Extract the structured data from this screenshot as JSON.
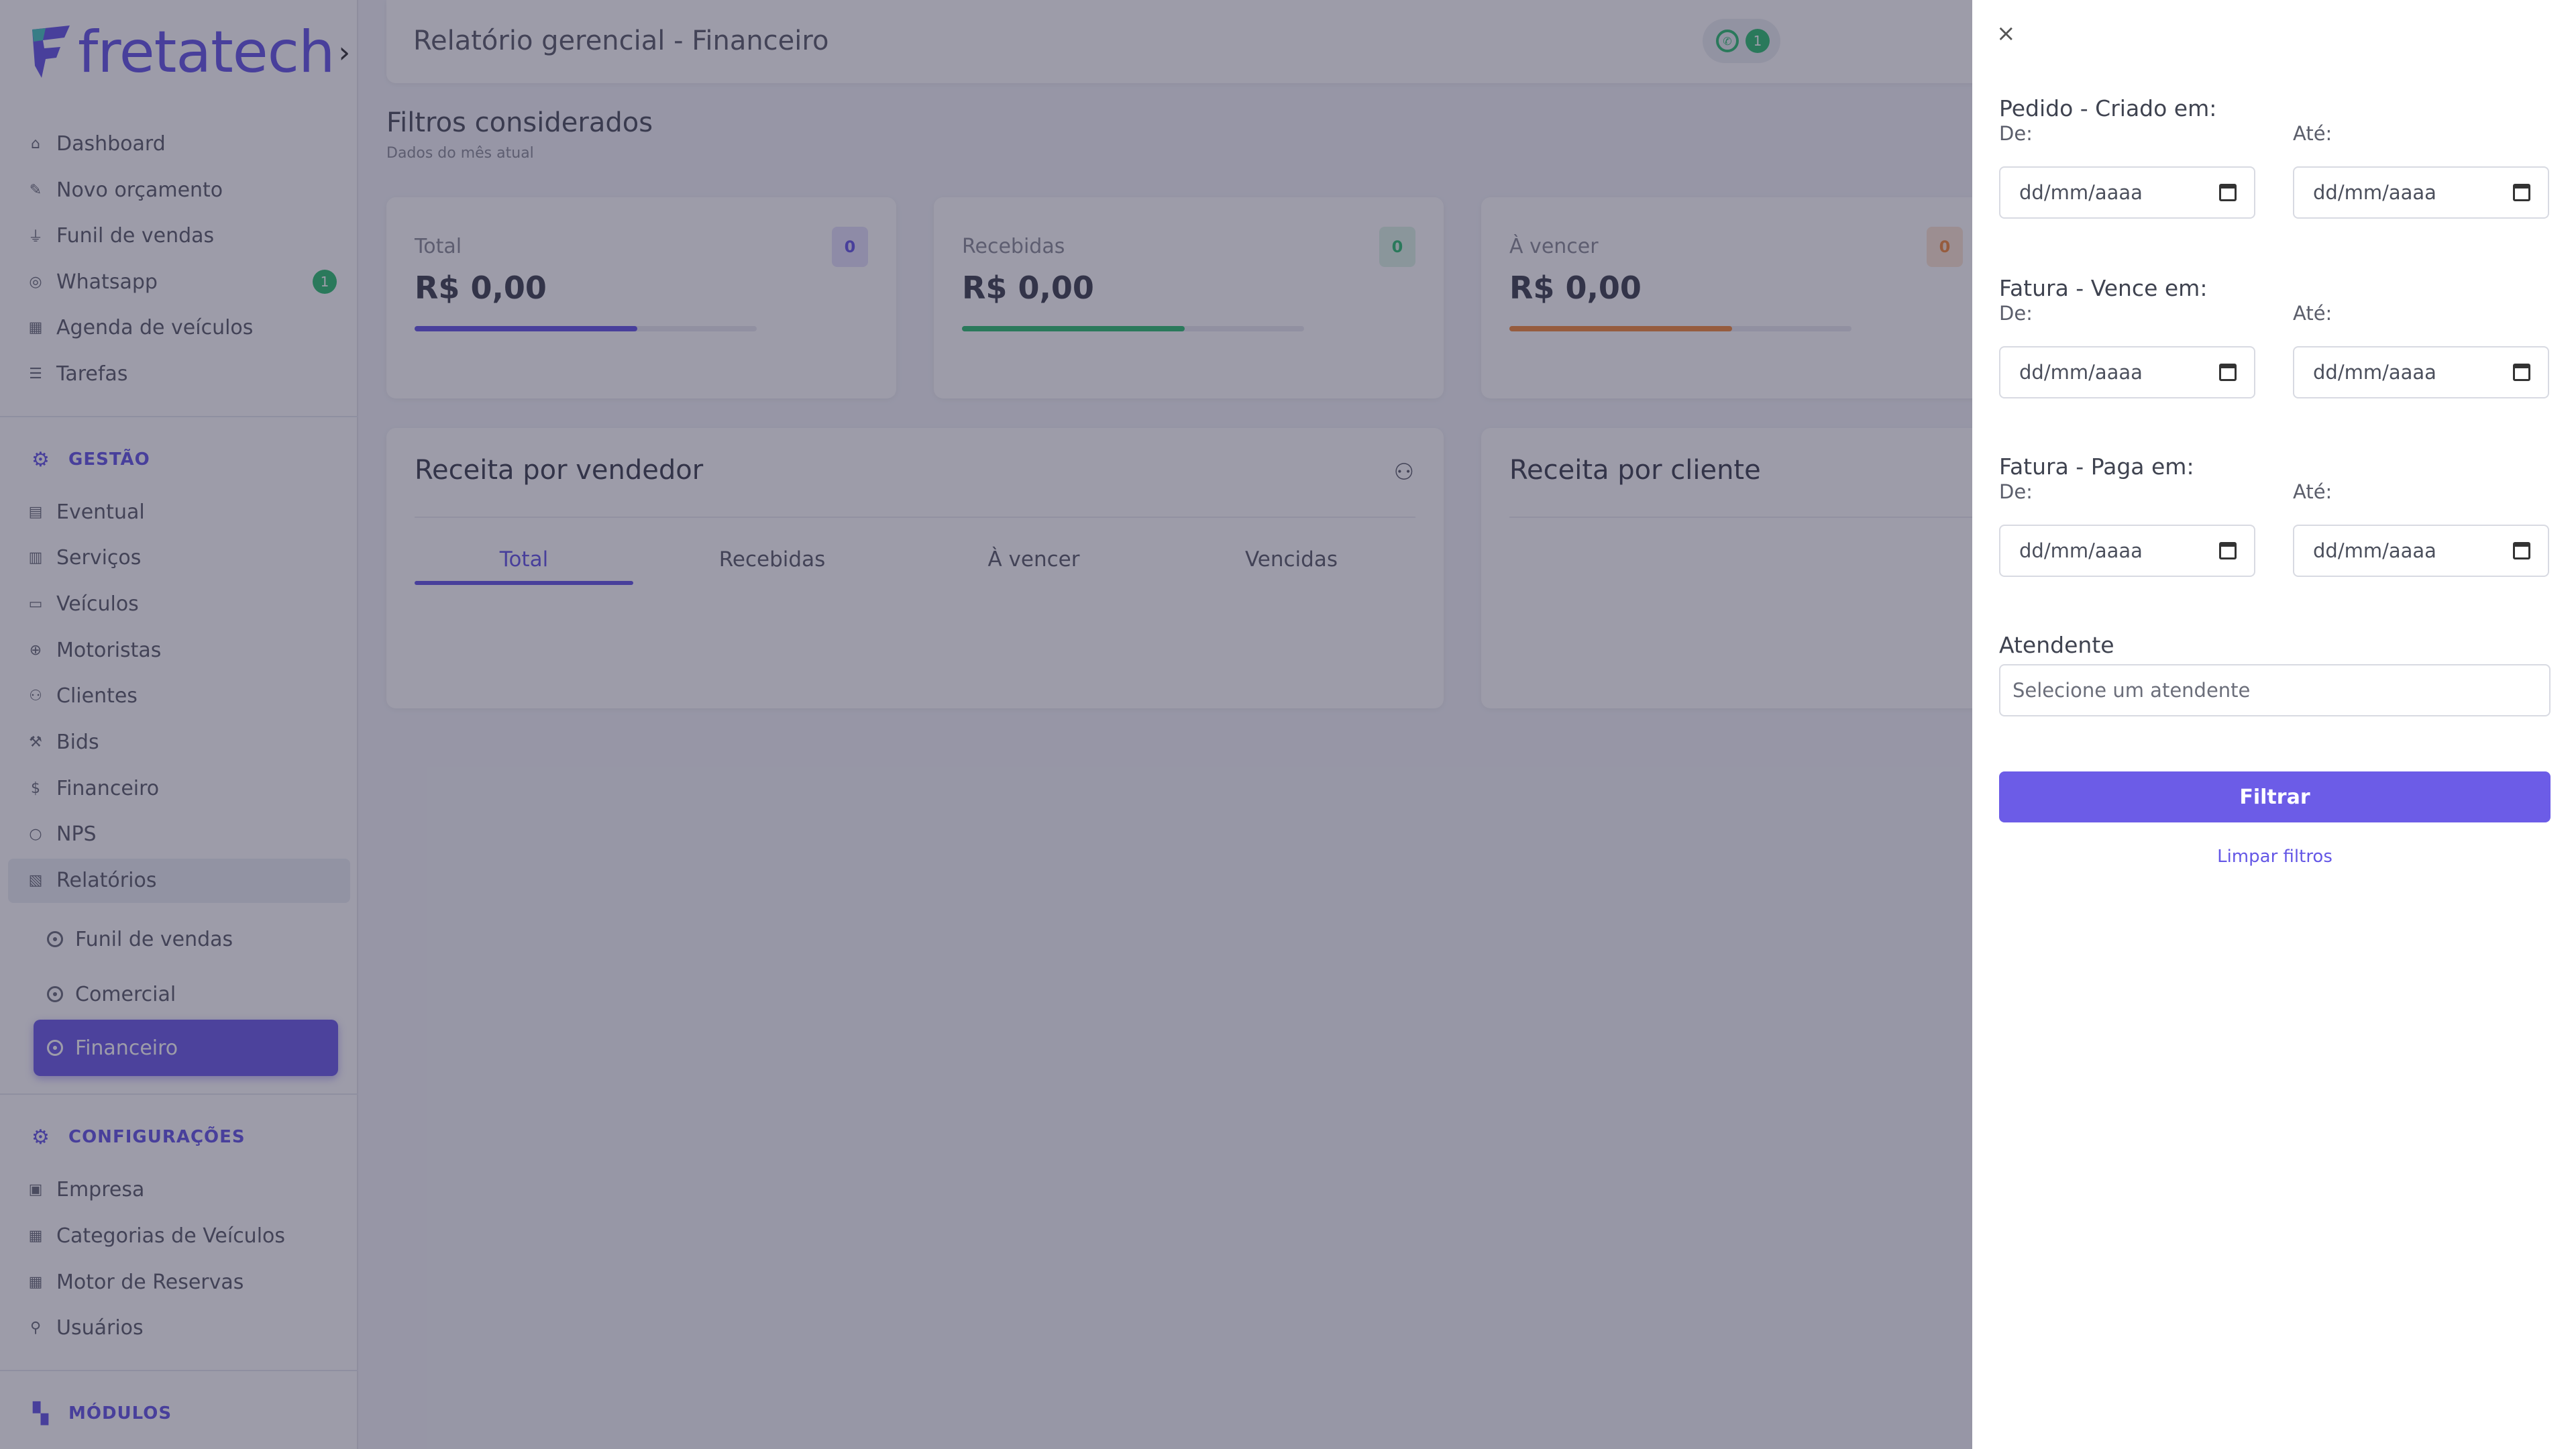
{
  "brand": {
    "name": "fretatech",
    "color": "#6457e6"
  },
  "sidebar": {
    "collapse_glyph": "›",
    "main_items": [
      {
        "label": "Dashboard",
        "icon": "home-icon"
      },
      {
        "label": "Novo orçamento",
        "icon": "edit-icon"
      },
      {
        "label": "Funil de vendas",
        "icon": "funnel-icon"
      },
      {
        "label": "Whatsapp",
        "icon": "whatsapp-icon",
        "badge": "1"
      },
      {
        "label": "Agenda de veículos",
        "icon": "calendar-icon"
      },
      {
        "label": "Tarefas",
        "icon": "list-icon"
      }
    ],
    "gestao": {
      "title": "GESTÃO",
      "items": [
        {
          "label": "Eventual",
          "icon": "file-icon"
        },
        {
          "label": "Serviços",
          "icon": "clipboard-icon"
        },
        {
          "label": "Veículos",
          "icon": "bus-icon"
        },
        {
          "label": "Motoristas",
          "icon": "steering-wheel-icon"
        },
        {
          "label": "Clientes",
          "icon": "users-icon"
        },
        {
          "label": "Bids",
          "icon": "gavel-icon"
        },
        {
          "label": "Financeiro",
          "icon": "money-icon"
        },
        {
          "label": "NPS",
          "icon": "chat-icon"
        },
        {
          "label": "Relatórios",
          "icon": "report-icon"
        }
      ],
      "reports_sub": [
        {
          "label": "Funil de vendas"
        },
        {
          "label": "Comercial"
        },
        {
          "label": "Financeiro",
          "active": true
        }
      ]
    },
    "configuracoes": {
      "title": "CONFIGURAÇÕES",
      "items": [
        {
          "label": "Empresa",
          "icon": "building-icon"
        },
        {
          "label": "Categorias de Veículos",
          "icon": "grid-icon"
        },
        {
          "label": "Motor de Reservas",
          "icon": "table-icon"
        },
        {
          "label": "Usuários",
          "icon": "user-icon"
        }
      ]
    },
    "modulos": {
      "title": "MÓDULOS"
    }
  },
  "header": {
    "title": "Relatório gerencial - Financeiro",
    "whatsapp_count": "1"
  },
  "filters": {
    "title": "Filtros considerados",
    "subtitle": "Dados do mês atual"
  },
  "kpis": [
    {
      "label": "Total",
      "value": "R$ 0,00",
      "badge": "0",
      "color": "#6457e6",
      "badge_bg": "#e4e1fb",
      "progress": 0.65
    },
    {
      "label": "Recebidas",
      "value": "R$ 0,00",
      "badge": "0",
      "color": "#2fbf71",
      "badge_bg": "#dcf4e6",
      "progress": 0.65
    },
    {
      "label": "À vencer",
      "value": "R$ 0,00",
      "badge": "0",
      "color": "#f28a3c",
      "badge_bg": "#fde6d4",
      "progress": 0.65
    }
  ],
  "panels": {
    "vendedor": {
      "title": "Receita por vendedor",
      "tabs": [
        "Total",
        "Recebidas",
        "À vencer",
        "Vencidas"
      ],
      "active_tab": 0
    },
    "cliente": {
      "title": "Receita por cliente"
    }
  },
  "drawer": {
    "close": "×",
    "groups": [
      {
        "title": "Pedido - Criado em:",
        "from_label": "De:",
        "to_label": "Até:",
        "from_value": "dd/mm/aaaa",
        "to_value": "dd/mm/aaaa"
      },
      {
        "title": "Fatura - Vence em:",
        "from_label": "De:",
        "to_label": "Até:",
        "from_value": "dd/mm/aaaa",
        "to_value": "dd/mm/aaaa"
      },
      {
        "title": "Fatura - Paga em:",
        "from_label": "De:",
        "to_label": "Até:",
        "from_value": "dd/mm/aaaa",
        "to_value": "dd/mm/aaaa"
      }
    ],
    "attendant": {
      "label": "Atendente",
      "placeholder": "Selecione um atendente"
    },
    "filter_button": "Filtrar",
    "clear_link": "Limpar filtros",
    "accent": "#6c5ce7"
  }
}
